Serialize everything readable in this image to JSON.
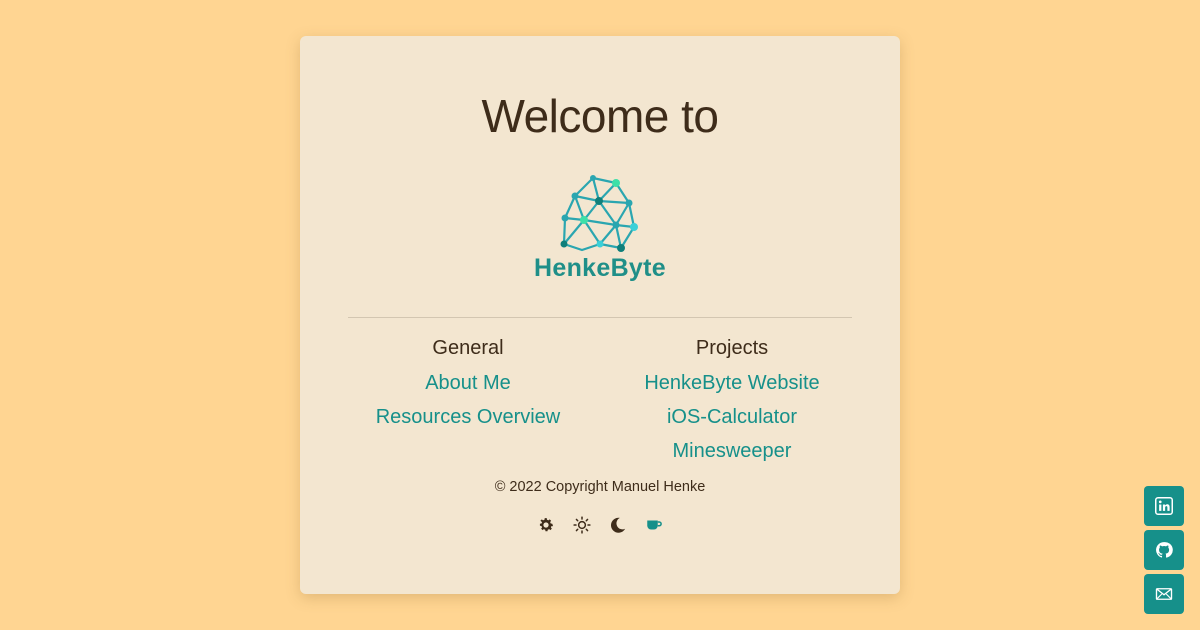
{
  "header": {
    "title": "Welcome to"
  },
  "brand": {
    "name": "HenkeByte",
    "logo_icon": "network-brain-logo"
  },
  "sections": {
    "general": {
      "title": "General",
      "links": [
        "About Me",
        "Resources Overview"
      ]
    },
    "projects": {
      "title": "Projects",
      "links": [
        "HenkeByte Website",
        "iOS-Calculator",
        "Minesweeper"
      ]
    }
  },
  "footer": {
    "copyright": "© 2022 Copyright Manuel Henke"
  },
  "theme_switcher": {
    "icons": [
      "gear-icon",
      "sun-icon",
      "moon-icon",
      "coffee-cup-icon"
    ],
    "active": "coffee-cup-icon"
  },
  "social_links": {
    "icons": [
      "linkedin-icon",
      "github-icon",
      "mail-icon"
    ]
  },
  "colors": {
    "background": "#ffd592",
    "card": "#f3e6d0",
    "accent": "#16908a",
    "text": "#3e2c1a"
  }
}
